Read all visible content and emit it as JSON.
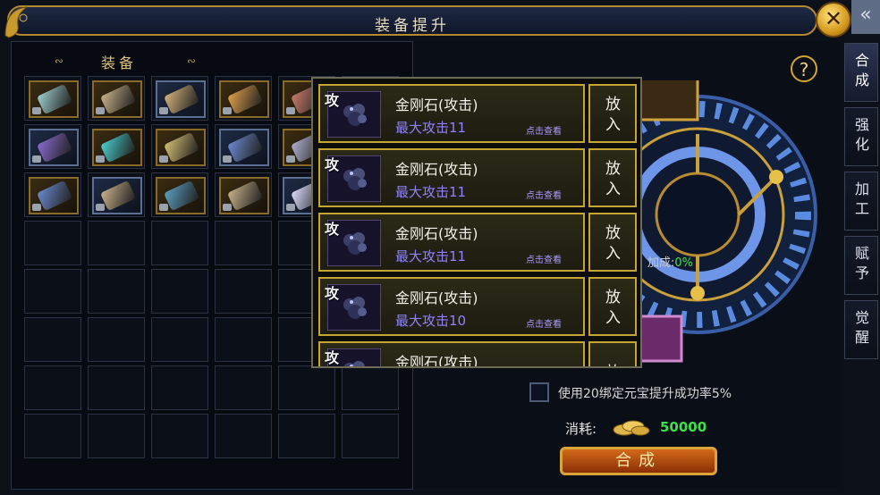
{
  "window": {
    "title": "装备提升",
    "close_symbol": "✕",
    "collapse_symbol": "«"
  },
  "left_panel": {
    "header": "装备"
  },
  "side_tabs": [
    "合成",
    "强化",
    "加工",
    "赋予",
    "觉醒"
  ],
  "help": {
    "symbol": "?"
  },
  "synthesis": {
    "bonus_prefix": "加成:",
    "bonus_value": "0%",
    "option_label": "使用20绑定元宝提升成功率5%",
    "cost_label": "消耗:",
    "cost_value": "50000",
    "button_label": "合成"
  },
  "popup": {
    "items": [
      {
        "tag": "攻",
        "name": "金刚石(攻击)",
        "stat": "最大攻击11",
        "link": "点击查看",
        "put": "放入"
      },
      {
        "tag": "攻",
        "name": "金刚石(攻击)",
        "stat": "最大攻击11",
        "link": "点击查看",
        "put": "放入"
      },
      {
        "tag": "攻",
        "name": "金刚石(攻击)",
        "stat": "最大攻击11",
        "link": "点击查看",
        "put": "放入"
      },
      {
        "tag": "攻",
        "name": "金刚石(攻击)",
        "stat": "最大攻击10",
        "link": "点击查看",
        "put": "放入"
      },
      {
        "tag": "攻",
        "name": "金刚石(攻击)",
        "stat": "",
        "link": "",
        "put": "放"
      }
    ]
  },
  "colors": {
    "gold": "#c6a433",
    "green": "#3ee04a",
    "purple_text": "#8f82ff"
  }
}
